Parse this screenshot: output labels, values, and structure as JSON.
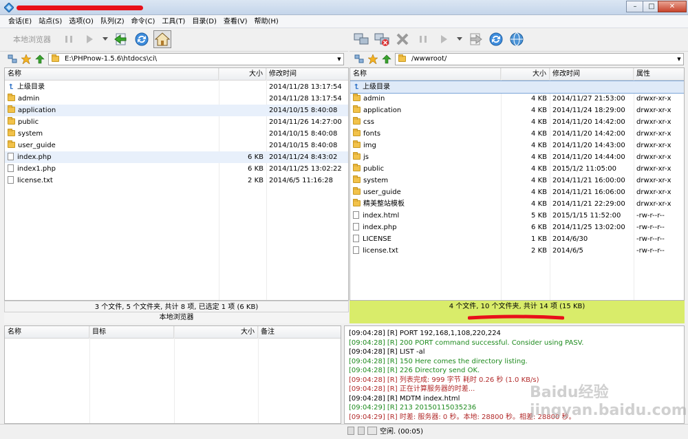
{
  "menu": [
    "会话(E)",
    "站点(S)",
    "选项(O)",
    "队列(Z)",
    "命令(C)",
    "工具(T)",
    "目录(D)",
    "查看(V)",
    "帮助(H)"
  ],
  "local": {
    "toolbar_label": "本地浏览器",
    "path": "E:\\PHPnow-1.5.6\\htdocs\\ci\\",
    "columns": [
      "名称",
      "大小",
      "修改时间"
    ],
    "rows": [
      {
        "name": "上级目录",
        "type": "parent",
        "size": "",
        "date": "2014/11/28 13:17:54"
      },
      {
        "name": "admin",
        "type": "folder",
        "size": "",
        "date": "2014/11/28 13:17:54"
      },
      {
        "name": "application",
        "type": "folder",
        "size": "",
        "date": "2014/10/15 8:40:08"
      },
      {
        "name": "public",
        "type": "folder",
        "size": "",
        "date": "2014/11/26 14:27:00"
      },
      {
        "name": "system",
        "type": "folder",
        "size": "",
        "date": "2014/10/15 8:40:08"
      },
      {
        "name": "user_guide",
        "type": "folder",
        "size": "",
        "date": "2014/10/15 8:40:08"
      },
      {
        "name": "index.php",
        "type": "file",
        "size": "6 KB",
        "date": "2014/11/24 8:43:02"
      },
      {
        "name": "index1.php",
        "type": "file",
        "size": "6 KB",
        "date": "2014/11/25 13:02:22"
      },
      {
        "name": "license.txt",
        "type": "file",
        "size": "2 KB",
        "date": "2014/6/5 11:16:28"
      }
    ],
    "status": "3 个文件, 5 个文件夹, 共计 8 项, 已选定 1 项 (6 KB)",
    "pane_name": "本地浏览器"
  },
  "remote": {
    "path": "/wwwroot/",
    "columns": [
      "名称",
      "大小",
      "修改时间",
      "属性"
    ],
    "rows": [
      {
        "name": "上级目录",
        "type": "parent",
        "size": "",
        "date": "",
        "attr": ""
      },
      {
        "name": "admin",
        "type": "folder",
        "size": "4 KB",
        "date": "2014/11/27 21:53:00",
        "attr": "drwxr-xr-x"
      },
      {
        "name": "application",
        "type": "folder",
        "size": "4 KB",
        "date": "2014/11/24 18:29:00",
        "attr": "drwxr-xr-x"
      },
      {
        "name": "css",
        "type": "folder",
        "size": "4 KB",
        "date": "2014/11/20 14:42:00",
        "attr": "drwxr-xr-x"
      },
      {
        "name": "fonts",
        "type": "folder",
        "size": "4 KB",
        "date": "2014/11/20 14:42:00",
        "attr": "drwxr-xr-x"
      },
      {
        "name": "img",
        "type": "folder",
        "size": "4 KB",
        "date": "2014/11/20 14:43:00",
        "attr": "drwxr-xr-x"
      },
      {
        "name": "js",
        "type": "folder",
        "size": "4 KB",
        "date": "2014/11/20 14:44:00",
        "attr": "drwxr-xr-x"
      },
      {
        "name": "public",
        "type": "folder",
        "size": "4 KB",
        "date": "2015/1/2 11:05:00",
        "attr": "drwxr-xr-x"
      },
      {
        "name": "system",
        "type": "folder",
        "size": "4 KB",
        "date": "2014/11/21 16:00:00",
        "attr": "drwxr-xr-x"
      },
      {
        "name": "user_guide",
        "type": "folder",
        "size": "4 KB",
        "date": "2014/11/21 16:06:00",
        "attr": "drwxr-xr-x"
      },
      {
        "name": "精美整站模板",
        "type": "folder",
        "size": "4 KB",
        "date": "2014/11/21 22:29:00",
        "attr": "drwxr-xr-x"
      },
      {
        "name": "index.html",
        "type": "file",
        "size": "5 KB",
        "date": "2015/1/15 11:52:00",
        "attr": "-rw-r--r--"
      },
      {
        "name": "index.php",
        "type": "file",
        "size": "6 KB",
        "date": "2014/11/25 13:02:00",
        "attr": "-rw-r--r--"
      },
      {
        "name": "LICENSE",
        "type": "file",
        "size": "1 KB",
        "date": "2014/6/30",
        "attr": "-rw-r--r--"
      },
      {
        "name": "license.txt",
        "type": "file",
        "size": "2 KB",
        "date": "2014/6/5",
        "attr": "-rw-r--r--"
      }
    ],
    "status": "4 个文件, 10 个文件夹, 共计 14 项 (15 KB)"
  },
  "queue": {
    "columns": [
      "名称",
      "目标",
      "大小",
      "备注"
    ]
  },
  "log": [
    {
      "text": "[09:04:28] [R] PORT 192,168,1,108,220,224",
      "color": "black"
    },
    {
      "text": "[09:04:28] [R] 200 PORT command successful. Consider using PASV.",
      "color": "green"
    },
    {
      "text": "[09:04:28] [R] LIST -al",
      "color": "black"
    },
    {
      "text": "[09:04:28] [R] 150 Here comes the directory listing.",
      "color": "green"
    },
    {
      "text": "[09:04:28] [R] 226 Directory send OK.",
      "color": "green"
    },
    {
      "text": "[09:04:28] [R] 列表完成: 999 字节 耗时 0.26 秒 (1.0 KB/s)",
      "color": "red"
    },
    {
      "text": "[09:04:28] [R] 正在计算服务器的时差...",
      "color": "red"
    },
    {
      "text": "[09:04:28] [R] MDTM index.html",
      "color": "black"
    },
    {
      "text": "[09:04:29] [R] 213 20150115035236",
      "color": "green"
    },
    {
      "text": "[09:04:29] [R] 时差: 服务器: 0 秒。本地: 28800 秒。相差: 28800 秒。",
      "color": "red"
    }
  ],
  "bottom_status": "空闲. (00:05)",
  "watermark": "Baidu经验 jingyan.baidu.com",
  "colors": {
    "remote_status_bg": "#d9ec6a",
    "redaction": "#e8101a",
    "selection": "#e8f0fb"
  }
}
